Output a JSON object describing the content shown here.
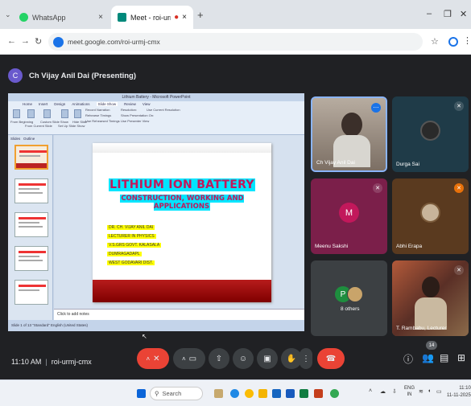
{
  "browser": {
    "tabs": [
      {
        "title": "WhatsApp",
        "active": false
      },
      {
        "title": "Meet - roi-urmj-cmx",
        "active": true
      }
    ],
    "url": "meet.google.com/roi-urmj-cmx"
  },
  "meet": {
    "presenter": {
      "initial": "C",
      "label": "Ch Vijay Anil Dai (Presenting)"
    },
    "shared_screen": {
      "window_title": "Lithium Battery - Microsoft PowerPoint",
      "ribbon_tabs": [
        "Home",
        "Insert",
        "Design",
        "Animations",
        "Slide Show",
        "Review",
        "View"
      ],
      "ribbon_items": [
        "From Beginning",
        "From Current Slide",
        "Custom Slide Show",
        "Set Up Slide Show",
        "Hide Slide",
        "Record Narration",
        "Rehearse Timings",
        "Use Rehearsed Timings",
        "Resolution:",
        "Use Current Resolution",
        "Show Presentation On:",
        "Use Presenter View"
      ],
      "pane_tabs": [
        "Slides",
        "Outline"
      ],
      "slide": {
        "title": "LITHIUM ION BATTERY",
        "subtitle": "CONSTRUCTION, WORKING AND APPLICATIONS",
        "author_lines": [
          "DR. CH. VIJAY ANIL DAI",
          "LECTURER IN PHYSICS",
          "V.S.GRS GOVT. KALASALA",
          "DUMRAGADAPL",
          "WEST GODAVARI DIST."
        ]
      },
      "notes_placeholder": "Click to add notes",
      "status": "Slide 1 of 13   \"Standard\"   English (United States)"
    },
    "participants": [
      {
        "name": "Ch Vijay Anil Dai",
        "avatar": "",
        "muted": false
      },
      {
        "name": "Durga Sai",
        "avatar": "",
        "muted": true
      },
      {
        "name": "Meenu Sakshi",
        "avatar": "M",
        "muted": true
      },
      {
        "name": "Abhi Erapa",
        "avatar": "",
        "muted": true
      },
      {
        "name": "8 others",
        "avatar": "P",
        "muted": false
      },
      {
        "name": "T. Rambabu, Lecturer",
        "avatar": "",
        "muted": true
      }
    ],
    "time": "11:10 AM",
    "meeting_code": "roi-urmj-cmx",
    "participant_count": "14",
    "controls": {
      "mic_icon": "mic-off-icon",
      "camera_icon": "camera-icon",
      "present_icon": "present-icon",
      "emoji_icon": "emoji-icon",
      "captions_icon": "captions-icon",
      "hand_icon": "raise-hand-icon",
      "more_icon": "more-icon",
      "leave_icon": "leave-call-icon"
    },
    "accent_red": "#ea4335",
    "background": "#202124"
  },
  "taskbar": {
    "search_placeholder": "Search",
    "lang": "ENG",
    "lang_sub": "IN",
    "clock_time": "11:10",
    "clock_date": "11-11-2025"
  }
}
